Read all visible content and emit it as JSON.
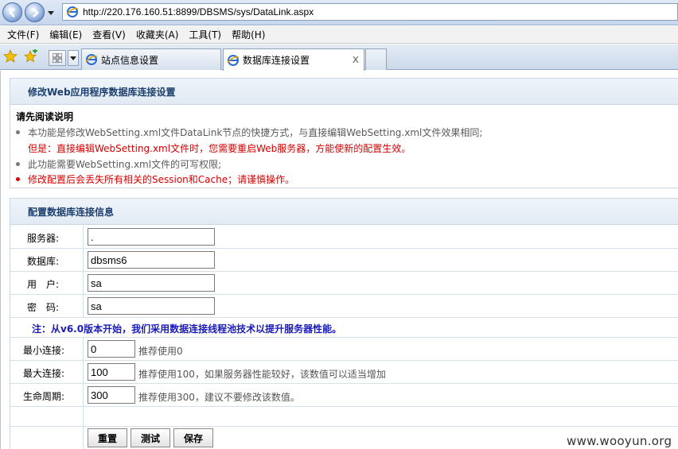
{
  "browser": {
    "url": "http://220.176.160.51:8899/DBSMS/sys/DataLink.aspx",
    "menu": [
      "文件(F)",
      "编辑(E)",
      "查看(V)",
      "收藏夹(A)",
      "工具(T)",
      "帮助(H)"
    ],
    "tabs": [
      {
        "label": "站点信息设置",
        "active": false
      },
      {
        "label": "数据库连接设置",
        "active": true
      }
    ],
    "tab_close_label": "x"
  },
  "page": {
    "title": "修改Web应用程序数据库连接设置",
    "intro_label": "请先阅读说明",
    "notes": [
      {
        "text": "本功能是修改WebSetting.xml文件DataLink节点的快捷方式，与直接编辑WebSetting.xml文件效果相同;",
        "color": "gray"
      },
      {
        "text": "但是：直接编辑WebSetting.xml文件时，您需要重启Web服务器，方能使新的配置生效。",
        "color": "red"
      },
      {
        "text": "此功能需要WebSetting.xml文件的可写权限;",
        "color": "gray"
      },
      {
        "text": "修改配置后会丢失所有相关的Session和Cache；请谨慎操作。",
        "color": "red"
      }
    ],
    "config_title": "配置数据库连接信息",
    "fields": {
      "server": {
        "label": "服务器:",
        "value": "."
      },
      "database": {
        "label": "数据库:",
        "value": "dbsms6"
      },
      "user": {
        "label": "用　户:",
        "value": "sa"
      },
      "password": {
        "label": "密　码:",
        "value": "sa"
      }
    },
    "pool_note": "注：从v6.0版本开始，我们采用数据连接线程池技术以提升服务器性能。",
    "pool": {
      "min": {
        "label": "最小连接:",
        "value": "0",
        "hint": "推荐使用0"
      },
      "max": {
        "label": "最大连接:",
        "value": "100",
        "hint": "推荐使用100，如果服务器性能较好，该数值可以适当增加"
      },
      "lifetime": {
        "label": "生命周期:",
        "value": "300",
        "hint": "推荐使用300，建议不要修改该数值。"
      }
    },
    "buttons": {
      "reset": "重置",
      "test": "测试",
      "save": "保存"
    }
  },
  "watermark": "www.wooyun.org",
  "colors": {
    "red": "#d60000",
    "gray": "#5a5a5a",
    "blue": "#1a1ab8",
    "title": "#1d3f6d"
  }
}
